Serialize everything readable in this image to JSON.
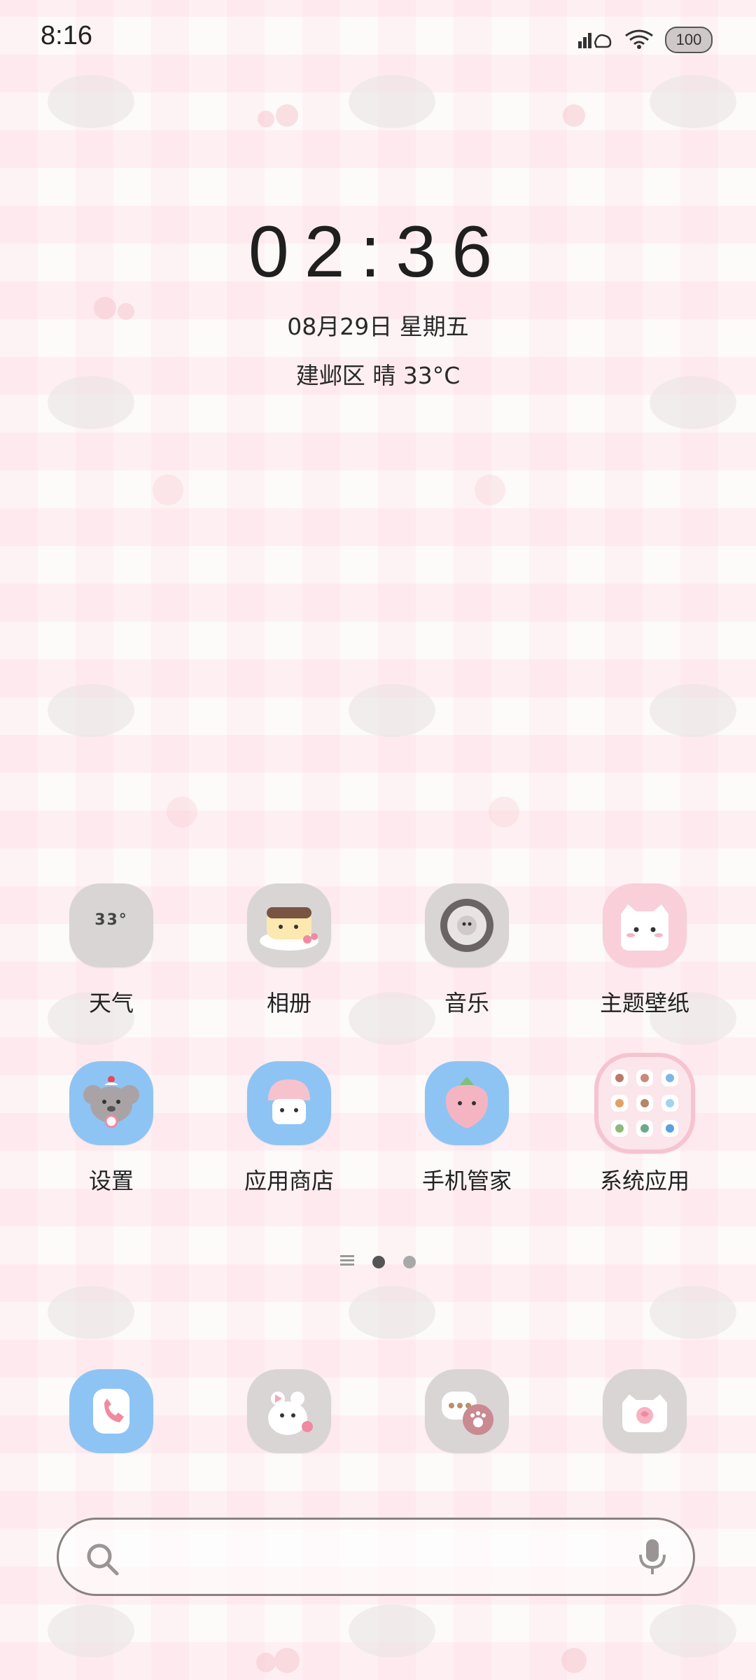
{
  "status_bar": {
    "time": "8:16",
    "battery_level": "100",
    "icons": [
      "signal-icon",
      "wifi-icon",
      "battery-icon"
    ]
  },
  "clock_widget": {
    "time": "02:36",
    "date": "08月29日 星期五",
    "weather": "建邺区 晴 33°C"
  },
  "apps": [
    {
      "label": "天气",
      "icon": "weather-icon",
      "icon_text": "33°"
    },
    {
      "label": "相册",
      "icon": "gallery-icon"
    },
    {
      "label": "音乐",
      "icon": "music-icon"
    },
    {
      "label": "主题壁纸",
      "icon": "themes-icon"
    },
    {
      "label": "设置",
      "icon": "settings-icon"
    },
    {
      "label": "应用商店",
      "icon": "app-store-icon"
    },
    {
      "label": "手机管家",
      "icon": "phone-manager-icon"
    },
    {
      "label": "系统应用",
      "icon": "system-apps-folder-icon"
    }
  ],
  "page_indicator": {
    "pages": 2,
    "current": 1
  },
  "dock": [
    {
      "icon": "phone-icon"
    },
    {
      "icon": "messages-icon"
    },
    {
      "icon": "chat-icon"
    },
    {
      "icon": "camera-icon"
    }
  ],
  "colors": {
    "blue_tile": "#8ec4f4",
    "gray_tile": "#d9d5d5",
    "pink_tile": "#f9cfd9",
    "dot_active": "#555555",
    "dot_inactive": "#a8a8a8"
  }
}
